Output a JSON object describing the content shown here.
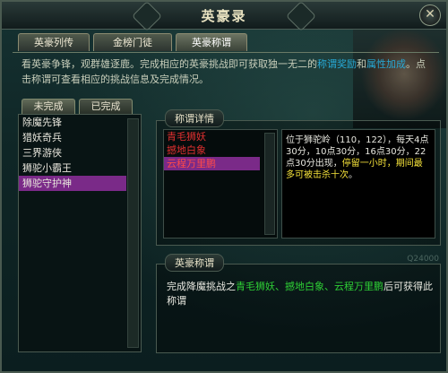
{
  "window": {
    "title": "英豪录",
    "close_glyph": "✕"
  },
  "tabs": [
    {
      "label": "英豪列传"
    },
    {
      "label": "金榜门徒"
    },
    {
      "label": "英豪称谓"
    }
  ],
  "intro": {
    "part1": "看英豪争锋，观群雄逐鹿。完成相应的英豪挑战即可获取独一无二的",
    "link1": "称谓奖励",
    "part2": "和",
    "link2": "属性加成",
    "part3": "。点击称谓可查看相应的挑战信息及完成情况。"
  },
  "subtabs": [
    {
      "label": "未完成"
    },
    {
      "label": "已完成"
    }
  ],
  "titles_list": [
    {
      "label": "除魔先锋"
    },
    {
      "label": "猎妖奇兵"
    },
    {
      "label": "三界游侠"
    },
    {
      "label": "狮驼小霸王"
    },
    {
      "label": "狮驼守护神"
    }
  ],
  "detail": {
    "label": "称谓详情",
    "monsters": [
      {
        "label": "青毛狮妖"
      },
      {
        "label": "撼地白象"
      },
      {
        "label": "云程万里鹏"
      }
    ],
    "desc_white1": "位于狮驼岭（110，122），每天4点30分，10点30分，16点30分，22点30分出现，",
    "desc_yellow": "停留一小时，期间最多可被击杀十次",
    "desc_white2": "。"
  },
  "hero_title": {
    "label": "英豪称谓",
    "text_pre": "完成降魔挑战之",
    "names": "青毛狮妖、撼地白象、云程万里鹏",
    "text_post": "后可获得此称谓"
  },
  "watermark": "Q24000"
}
